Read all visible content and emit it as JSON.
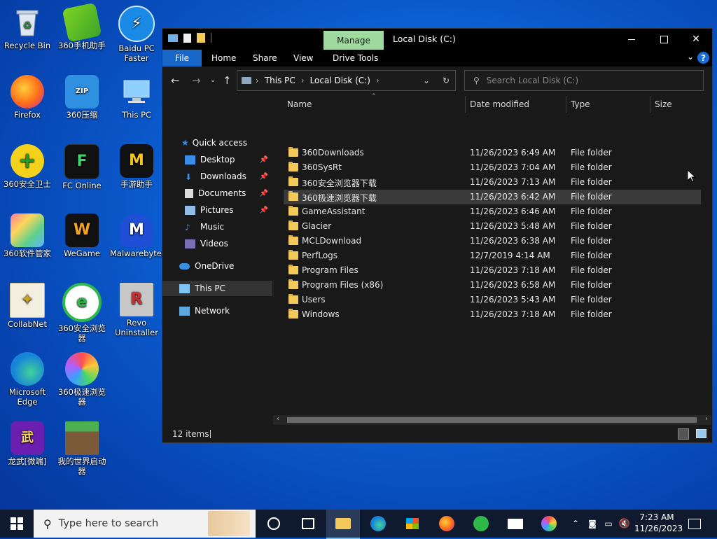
{
  "desktop": {
    "icons": [
      {
        "label": "Recycle Bin",
        "icon": "recycle-bin-icon"
      },
      {
        "label": "360手机助手",
        "icon": "360-phone-assistant-icon"
      },
      {
        "label": "Baidu PC Faster",
        "icon": "baidu-pc-faster-icon"
      },
      {
        "label": "Firefox",
        "icon": "firefox-icon"
      },
      {
        "label": "360压缩",
        "icon": "360-zip-icon"
      },
      {
        "label": "This PC",
        "icon": "this-pc-icon"
      },
      {
        "label": "360安全卫士",
        "icon": "360-security-icon"
      },
      {
        "label": "FC Online",
        "icon": "fc-online-icon"
      },
      {
        "label": "手游助手",
        "icon": "mobile-game-assistant-icon"
      },
      {
        "label": "360软件管家",
        "icon": "360-software-manager-icon"
      },
      {
        "label": "WeGame",
        "icon": "wegame-icon"
      },
      {
        "label": "Malwarebytes",
        "icon": "malwarebytes-icon"
      },
      {
        "label": "CollabNet",
        "icon": "collabnet-icon"
      },
      {
        "label": "360安全浏览器",
        "icon": "360-secure-browser-icon"
      },
      {
        "label": "Revo Uninstaller",
        "icon": "revo-uninstaller-icon"
      },
      {
        "label": "Microsoft Edge",
        "icon": "edge-icon"
      },
      {
        "label": "360极速浏览器",
        "icon": "360-speed-browser-icon"
      },
      {
        "label": "龙武[微端]",
        "icon": "longwu-icon"
      },
      {
        "label": "我的世界启动器",
        "icon": "minecraft-launcher-icon"
      }
    ]
  },
  "window": {
    "title": "Local Disk (C:)",
    "manage_tab": "Manage",
    "ribbon_tabs": [
      "File",
      "Home",
      "Share",
      "View",
      "Drive Tools"
    ],
    "address": [
      "This PC",
      "Local Disk (C:)"
    ],
    "search_placeholder": "Search Local Disk (C:)",
    "nav": {
      "quick_access": "Quick access",
      "items": [
        "Desktop",
        "Downloads",
        "Documents",
        "Pictures",
        "Music",
        "Videos"
      ],
      "onedrive": "OneDrive",
      "this_pc": "This PC",
      "network": "Network"
    },
    "columns": [
      "Name",
      "Date modified",
      "Type",
      "Size"
    ],
    "files": [
      {
        "name": "360Downloads",
        "date": "11/26/2023 6:49 AM",
        "type": "File folder"
      },
      {
        "name": "360SysRt",
        "date": "11/26/2023 7:04 AM",
        "type": "File folder"
      },
      {
        "name": "360安全浏览器下载",
        "date": "11/26/2023 7:13 AM",
        "type": "File folder"
      },
      {
        "name": "360极速浏览器下载",
        "date": "11/26/2023 6:42 AM",
        "type": "File folder"
      },
      {
        "name": "GameAssistant",
        "date": "11/26/2023 6:46 AM",
        "type": "File folder"
      },
      {
        "name": "Glacier",
        "date": "11/26/2023 5:48 AM",
        "type": "File folder"
      },
      {
        "name": "MCLDownload",
        "date": "11/26/2023 6:38 AM",
        "type": "File folder"
      },
      {
        "name": "PerfLogs",
        "date": "12/7/2019 4:14 AM",
        "type": "File folder"
      },
      {
        "name": "Program Files",
        "date": "11/26/2023 7:18 AM",
        "type": "File folder"
      },
      {
        "name": "Program Files (x86)",
        "date": "11/26/2023 6:58 AM",
        "type": "File folder"
      },
      {
        "name": "Users",
        "date": "11/26/2023 5:43 AM",
        "type": "File folder"
      },
      {
        "name": "Windows",
        "date": "11/26/2023 7:18 AM",
        "type": "File folder"
      }
    ],
    "status": "12 items"
  },
  "taskbar": {
    "search_placeholder": "Type here to search",
    "time": "7:23 AM",
    "date": "11/26/2023"
  }
}
